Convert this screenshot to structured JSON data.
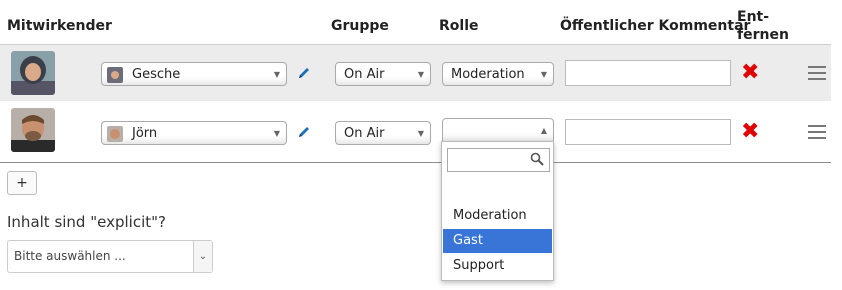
{
  "headers": {
    "contributor": "Mitwirkender",
    "group": "Gruppe",
    "role": "Rolle",
    "comment": "Öffentlicher Kommentar",
    "remove_line1": "Ent-",
    "remove_line2": "fernen"
  },
  "rows": [
    {
      "name": "Gesche",
      "group": "On Air",
      "role": "Moderation",
      "comment": ""
    },
    {
      "name": "Jörn",
      "group": "On Air",
      "role": "",
      "comment": ""
    }
  ],
  "dropdown": {
    "search_value": "",
    "options": [
      "Moderation",
      "Gast",
      "Support"
    ],
    "highlighted": "Gast"
  },
  "add_button_label": "+",
  "explicit": {
    "question": "Inhalt sind \"explicit\"?",
    "placeholder": "Bitte auswählen ..."
  },
  "colors": {
    "accent": "#3875d7",
    "remove": "#e00000",
    "row_highlight": "#ececec"
  },
  "icons": {
    "edit": "pencil-icon",
    "remove": "x-icon",
    "reorder": "hamburger-icon",
    "search": "magnifier-icon"
  }
}
